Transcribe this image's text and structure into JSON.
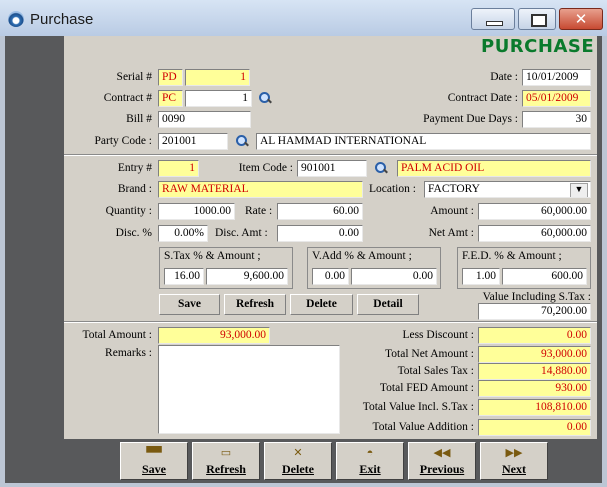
{
  "window": {
    "title": "Purchase"
  },
  "heading": "PURCHASE",
  "header": {
    "serial_label": "Serial #",
    "serial_prefix": "PD",
    "serial_no": "1",
    "contract_label": "Contract #",
    "contract_prefix": "PC",
    "contract_no": "1",
    "bill_label": "Bill #",
    "bill_no": "0090",
    "party_label": "Party Code :",
    "party_code": "201001",
    "party_name": "AL HAMMAD INTERNATIONAL",
    "date_label": "Date :",
    "date": "10/01/2009",
    "contract_date_label": "Contract Date :",
    "contract_date": "05/01/2009",
    "due_days_label": "Payment Due Days :",
    "due_days": "30"
  },
  "entry": {
    "entry_label": "Entry #",
    "entry_no": "1",
    "item_code_label": "Item Code :",
    "item_code": "901001",
    "item_name": "PALM ACID OIL",
    "brand_label": "Brand :",
    "brand": "RAW MATERIAL",
    "location_label": "Location :",
    "location": "FACTORY",
    "quantity_label": "Quantity :",
    "quantity": "1000.00",
    "rate_label": "Rate :",
    "rate": "60.00",
    "amount_label": "Amount :",
    "amount": "60,000.00",
    "disc_label": "Disc. %",
    "disc_pct": "0.00%",
    "disc_amt_label": "Disc. Amt :",
    "disc_amt": "0.00",
    "net_amt_label": "Net Amt :",
    "net_amt": "60,000.00",
    "stax_title": "S.Tax % & Amount ;",
    "stax_pct": "16.00",
    "stax_amt": "9,600.00",
    "vadd_title": "V.Add % & Amount ;",
    "vadd_pct": "0.00",
    "vadd_amt": "0.00",
    "fed_title": "F.E.D. % & Amount ;",
    "fed_pct": "1.00",
    "fed_amt": "600.00",
    "value_incl_label": "Value Including S.Tax :",
    "value_incl": "70,200.00",
    "buttons": {
      "save": "Save",
      "refresh": "Refresh",
      "delete": "Delete",
      "detail": "Detail"
    }
  },
  "totals": {
    "total_amount_label": "Total Amount :",
    "total_amount": "93,000.00",
    "remarks_label": "Remarks :",
    "less_discount_label": "Less Discount :",
    "less_discount": "0.00",
    "total_net_label": "Total Net Amount :",
    "total_net": "93,000.00",
    "total_sales_tax_label": "Total Sales Tax :",
    "total_sales_tax": "14,880.00",
    "total_fed_label": "Total FED Amount :",
    "total_fed": "930.00",
    "total_value_incl_label": "Total Value Incl. S.Tax :",
    "total_value_incl": "108,810.00",
    "total_value_add_label": "Total Value Addition :",
    "total_value_add": "0.00"
  },
  "toolbar": {
    "save": "Save",
    "refresh": "Refresh",
    "delete": "Delete",
    "exit": "Exit",
    "previous": "Previous",
    "next": "Next"
  },
  "colors": {
    "heading": "#0a7a2c",
    "highlight_field": "#ffff99",
    "highlight_text": "#d00000",
    "side_bar": "#58595b",
    "form_bg": "#d4d0c8"
  }
}
